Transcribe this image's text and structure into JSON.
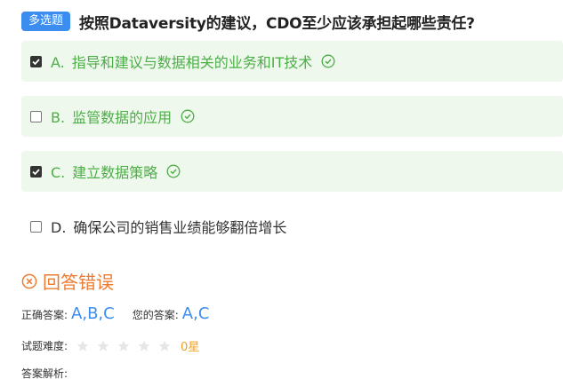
{
  "question": {
    "type_badge": "多选题",
    "title": "按照Dataversity的建议，CDO至少应该承担起哪些责任?"
  },
  "options": [
    {
      "letter": "A.",
      "text": "指导和建议与数据相关的业务和IT技术",
      "checked": true,
      "correct": true,
      "shaded": true
    },
    {
      "letter": "B.",
      "text": "监管数据的应用",
      "checked": false,
      "correct": true,
      "shaded": true
    },
    {
      "letter": "C.",
      "text": "建立数据策略",
      "checked": true,
      "correct": true,
      "shaded": true
    },
    {
      "letter": "D.",
      "text": "确保公司的销售业绩能够翻倍增长",
      "checked": false,
      "correct": false,
      "shaded": false
    }
  ],
  "result": {
    "status_text": "回答错误",
    "status_icon": "x-circle-icon",
    "correct_label": "正确答案:",
    "correct_value": "A,B,C",
    "your_label": "您的答案:",
    "your_value": "A,C",
    "difficulty_label": "试题难度:",
    "difficulty_stars": 0,
    "difficulty_max": 5,
    "difficulty_value": "0星",
    "analysis_label": "答案解析:"
  },
  "colors": {
    "badge": "#3b8df0",
    "correct_green": "#4dae48",
    "shaded_bg": "#eef8ec",
    "error_orange": "#ee7a2f",
    "answer_blue": "#3b8df0",
    "star_gray": "#e6e6e6",
    "difficulty_orange": "#f0a11b"
  }
}
